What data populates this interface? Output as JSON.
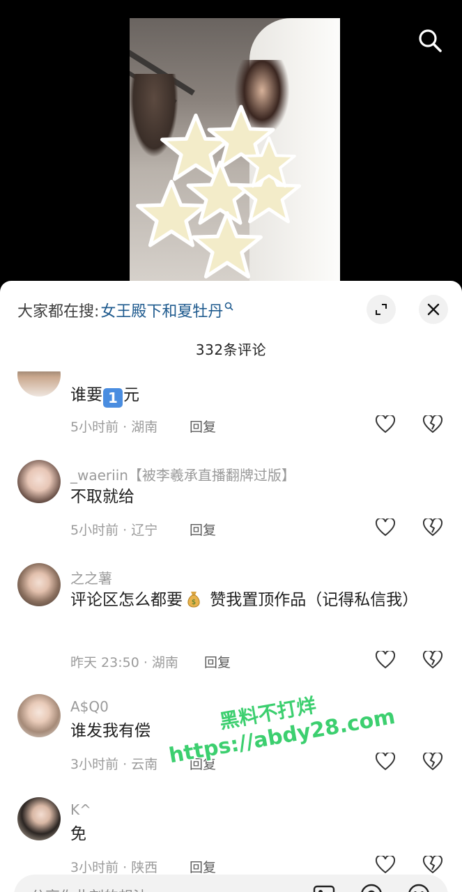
{
  "header": {
    "trend_prefix": "大家都在搜:",
    "trend_keyword": "女王殿下和夏牡丹"
  },
  "comment_count": "332条评论",
  "comments": [
    {
      "username": "",
      "text_before": "谁要",
      "emoji": "1",
      "text_after": "元",
      "time_location": "5小时前 · 湖南",
      "reply": "回复"
    },
    {
      "username": "_waeriin【被李羲承直播翻牌过版】",
      "text": "不取就给",
      "time_location": "5小时前 · 辽宁",
      "reply": "回复"
    },
    {
      "username": "之之薯",
      "text_before": "评论区怎么都要",
      "emoji": "money-bag",
      "text_after": " 赞我置顶作品（记得私信我）",
      "time_location": "昨天 23:50 · 湖南",
      "reply": "回复"
    },
    {
      "username": "A$Q0",
      "text": "谁发我有偿",
      "time_location": "3小时前 · 云南",
      "reply": "回复"
    },
    {
      "username": "K^",
      "text": "免",
      "time_location": "3小时前 · 陕西",
      "reply": "回复"
    }
  ],
  "input": {
    "placeholder": "分享你此刻的想法"
  },
  "watermark": {
    "line1": "黑料不打烊",
    "line2": "https://abdy28.com"
  },
  "colors": {
    "accent_keyword": "#1e5a8e",
    "watermark": "#3ccf6f",
    "sheet_bg": "#ffffff",
    "video_bg": "#000000"
  },
  "icons": [
    "search-icon",
    "expand-icon",
    "close-icon",
    "heart-icon",
    "broken-heart-icon",
    "image-icon",
    "at-icon",
    "emoji-icon"
  ]
}
